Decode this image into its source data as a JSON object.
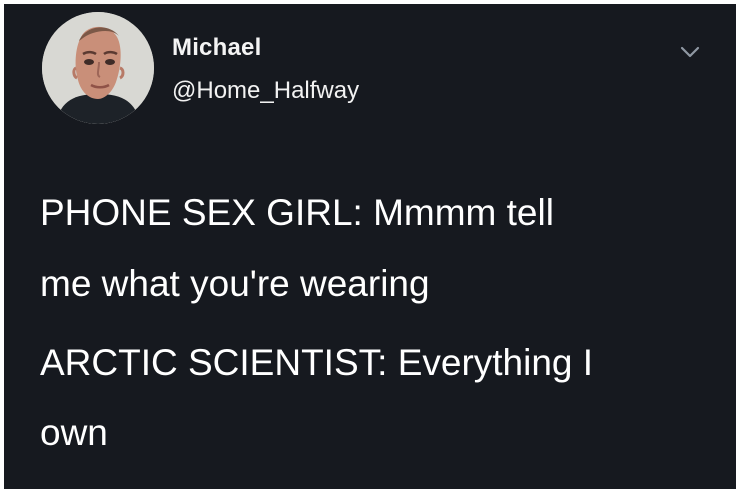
{
  "user": {
    "name": "Michael",
    "handle": "@Home_Halfway"
  },
  "icons": {
    "menu": "chevron-down-icon",
    "avatar": "avatar"
  },
  "tweet": {
    "lines": [
      "PHONE SEX GIRL: Mmmm tell",
      "me what you're wearing",
      "ARCTIC SCIENTIST: Everything I",
      "own"
    ]
  },
  "colors": {
    "background": "#16191f",
    "text": "#ffffff",
    "muted": "#8f98a3"
  }
}
